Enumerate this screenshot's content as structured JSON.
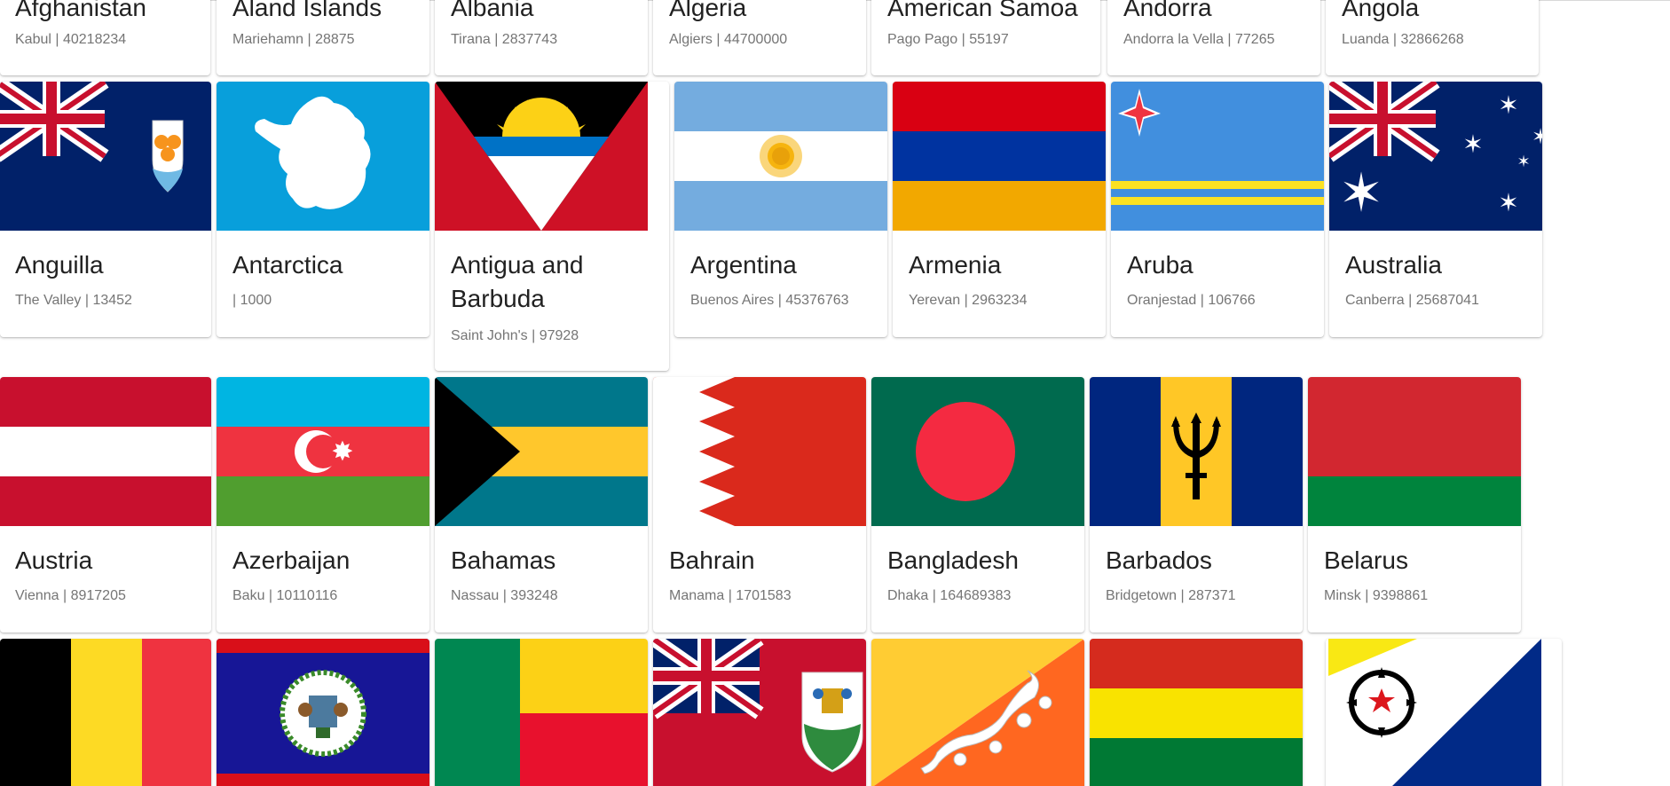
{
  "countries": {
    "row0": [
      {
        "name": "Afghanistan",
        "sub": "Kabul | 40218234"
      },
      {
        "name": "Aland Islands",
        "sub": "Mariehamn | 28875"
      },
      {
        "name": "Albania",
        "sub": "Tirana | 2837743"
      },
      {
        "name": "Algeria",
        "sub": "Algiers | 44700000"
      },
      {
        "name": "American Samoa",
        "sub": "Pago Pago | 55197"
      },
      {
        "name": "Andorra",
        "sub": "Andorra la Vella | 77265"
      },
      {
        "name": "Angola",
        "sub": "Luanda | 32866268"
      }
    ],
    "row1": [
      {
        "name": "Anguilla",
        "sub": "The Valley | 13452",
        "flag": "anguilla-flag"
      },
      {
        "name": "Antarctica",
        "sub": "| 1000",
        "flag": "antarctica-flag"
      },
      {
        "name": "Antigua and Barbuda",
        "sub": "Saint John's | 97928",
        "flag": "antigua-and-barbuda-flag"
      },
      {
        "name": "Argentina",
        "sub": "Buenos Aires | 45376763",
        "flag": "argentina-flag"
      },
      {
        "name": "Armenia",
        "sub": "Yerevan | 2963234",
        "flag": "armenia-flag"
      },
      {
        "name": "Aruba",
        "sub": "Oranjestad | 106766",
        "flag": "aruba-flag"
      },
      {
        "name": "Australia",
        "sub": "Canberra | 25687041",
        "flag": "australia-flag"
      }
    ],
    "row2": [
      {
        "name": "Austria",
        "sub": "Vienna | 8917205",
        "flag": "austria-flag"
      },
      {
        "name": "Azerbaijan",
        "sub": "Baku | 10110116",
        "flag": "azerbaijan-flag"
      },
      {
        "name": "Bahamas",
        "sub": "Nassau | 393248",
        "flag": "bahamas-flag"
      },
      {
        "name": "Bahrain",
        "sub": "Manama | 1701583",
        "flag": "bahrain-flag"
      },
      {
        "name": "Bangladesh",
        "sub": "Dhaka | 164689383",
        "flag": "bangladesh-flag"
      },
      {
        "name": "Barbados",
        "sub": "Bridgetown | 287371",
        "flag": "barbados-flag"
      },
      {
        "name": "Belarus",
        "sub": "Minsk | 9398861",
        "flag": "belarus-flag"
      }
    ],
    "row3": [
      {
        "flag": "belgium-flag"
      },
      {
        "flag": "belize-flag"
      },
      {
        "flag": "benin-flag"
      },
      {
        "flag": "bermuda-flag"
      },
      {
        "flag": "bhutan-flag"
      },
      {
        "flag": "bolivia-flag"
      },
      {
        "flag": "bonaire-flag"
      }
    ]
  },
  "colors": {
    "card_title": "#212121",
    "card_subtitle": "#757575",
    "page_background": "#ffffff"
  }
}
